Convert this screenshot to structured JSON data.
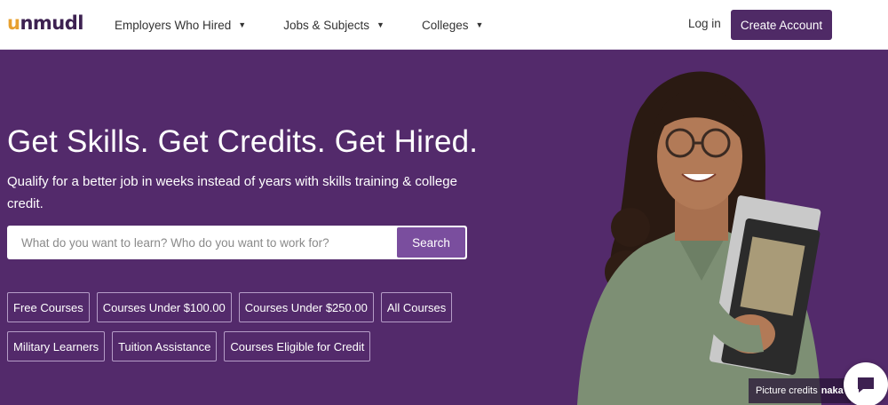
{
  "header": {
    "logo": "unmudl",
    "nav": [
      {
        "label": "Employers Who Hired"
      },
      {
        "label": "Jobs & Subjects"
      },
      {
        "label": "Colleges"
      }
    ],
    "login_label": "Log in",
    "create_account_label": "Create Account"
  },
  "hero": {
    "title": "Get Skills. Get Credits. Get Hired.",
    "subtitle": "Qualify for a better job in weeks instead of years with skills training & college credit.",
    "search": {
      "placeholder": "What do you want to learn? Who do you want to work for?",
      "button_label": "Search"
    },
    "chips_row1": [
      "Free Courses",
      "Courses Under $100.00",
      "Courses Under $250.00",
      "All Courses"
    ],
    "chips_row2": [
      "Military Learners",
      "Tuition Assistance",
      "Courses Eligible for Credit"
    ],
    "picture_credits_label": "Picture credits",
    "picture_credits_brand": "naka"
  },
  "colors": {
    "brand_purple": "#532a6b",
    "button_purple": "#4f2a66",
    "search_button": "#7a4e9e",
    "logo_accent": "#e7a02f"
  },
  "icons": [
    "chevron-down-icon",
    "chat-icon"
  ]
}
